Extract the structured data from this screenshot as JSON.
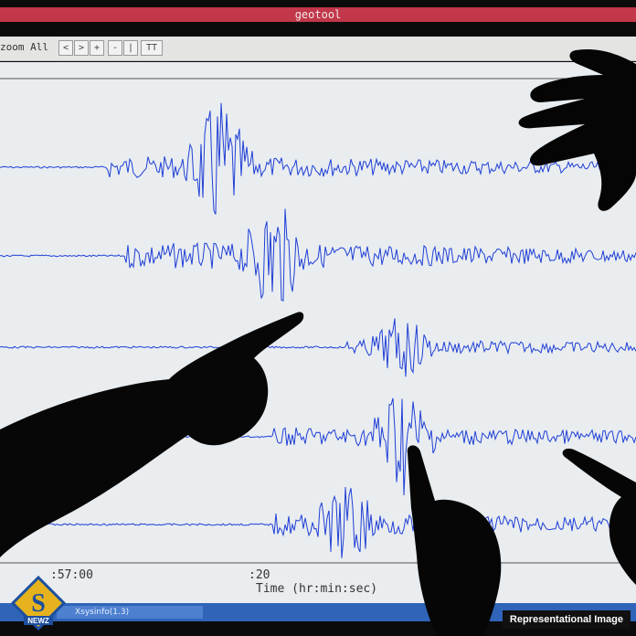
{
  "app": {
    "title": "geotool"
  },
  "toolbar": {
    "zoom_label": "zoom All",
    "buttons": [
      "<",
      ">",
      "+",
      "-",
      "|",
      "TT"
    ]
  },
  "axis": {
    "tick_left": ":57:00",
    "tick_mid": ":20",
    "xlabel": "Time (hr:min:sec)"
  },
  "taskbar": {
    "task_label": "Xsysinfo(1.3)"
  },
  "logo": {
    "letter": "S",
    "text": "NEWZ"
  },
  "caption": "Representational Image",
  "colors": {
    "trace": "#1f3fd6",
    "background": "#e9edf0",
    "titlebar": "#c2374a"
  }
}
